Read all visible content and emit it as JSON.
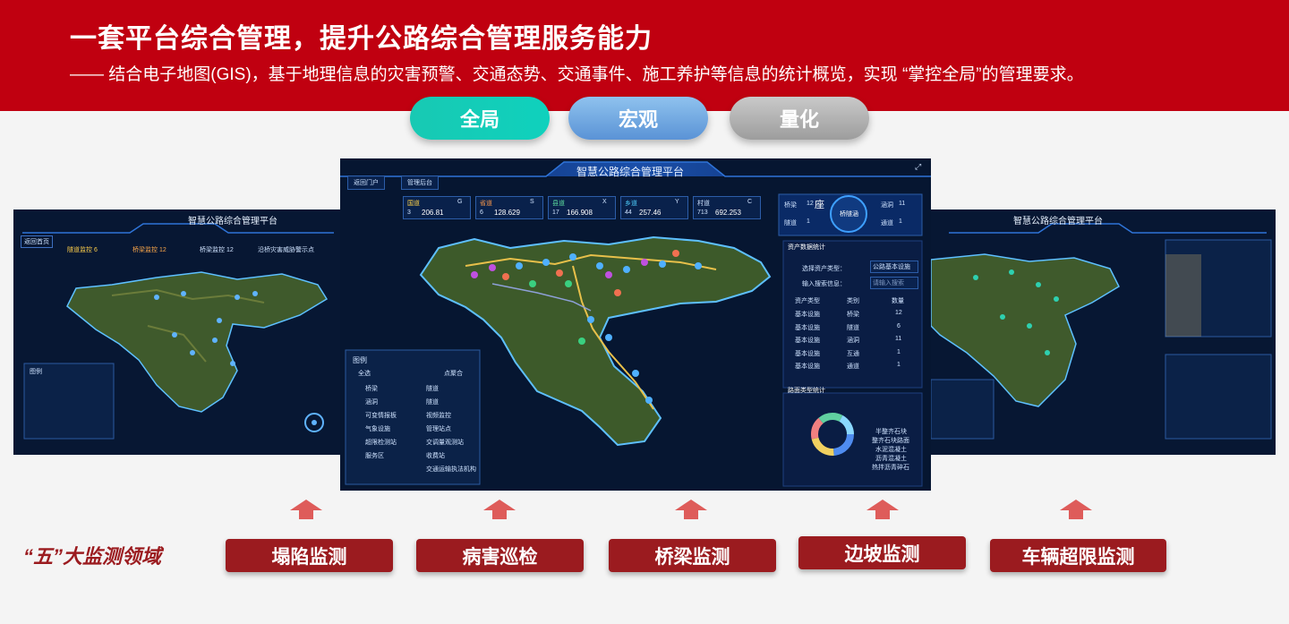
{
  "header": {
    "title": "一套平台综合管理，提升公路综合管理服务能力",
    "subtitle": "—— 结合电子地图(GIS)，基于地理信息的灾害预警、交通态势、交通事件、施工养护等信息的统计概览，实现 “掌控全局”的管理要求。"
  },
  "pills": [
    "全局",
    "宏观",
    "量化"
  ],
  "platform": {
    "title": "智慧公路综合管理平台",
    "back_label": "返回门户",
    "admin_label": "管理后台",
    "stats": [
      {
        "name": "国道",
        "code": "G",
        "count": "3",
        "length": "206.81"
      },
      {
        "name": "省道",
        "code": "S",
        "count": "6",
        "length": "128.629"
      },
      {
        "name": "县道",
        "code": "X",
        "count": "17",
        "length": "166.908"
      },
      {
        "name": "乡道",
        "code": "Y",
        "count": "44",
        "length": "257.46"
      },
      {
        "name": "村道",
        "code": "C",
        "count": "713",
        "length": "692.253"
      }
    ],
    "unit_count": "条",
    "unit_length": "km",
    "bridge": {
      "label": "桥梁",
      "value": "12",
      "unit": "座"
    },
    "culvert": {
      "label": "涵洞",
      "value": "11"
    },
    "tunnel": {
      "label": "隧道",
      "value": "1"
    },
    "passage": {
      "label": "通道",
      "value": "1"
    },
    "bridge_tunnel": "桥隧涵",
    "asset_title": "资产数据统计",
    "asset_type_label": "选择资产类型：",
    "asset_type_value": "公路基本设施",
    "search_label": "输入搜索信息：",
    "search_placeholder": "请输入搜索",
    "table_headers": [
      "资产类型",
      "类别",
      "数量"
    ],
    "table_rows": [
      [
        "基本设施",
        "桥梁",
        "12"
      ],
      [
        "基本设施",
        "隧道",
        "6"
      ],
      [
        "基本设施",
        "涵洞",
        "11"
      ],
      [
        "基本设施",
        "互通",
        "1"
      ],
      [
        "基本设施",
        "通道",
        "1"
      ]
    ],
    "pavement_title": "路面类型统计",
    "pavement_legend": [
      "半整齐石块",
      "整齐石块路面",
      "水泥混凝土",
      "沥青混凝土",
      "热拌沥青碎石"
    ],
    "pavement_colors": [
      "#4f8cf0",
      "#f0d060",
      "#f08080",
      "#60d0a0",
      "#8ad8ff"
    ],
    "legend_title": "图例",
    "legend_all": "全选",
    "legend_cluster": "点聚合",
    "legend_items": [
      "桥梁",
      "隧道",
      "涵洞",
      "隧道",
      "可变情报板",
      "视频监控",
      "气象设施",
      "管理站点",
      "超限检测站",
      "交调量观测站",
      "服务区",
      "收费站",
      "",
      "交通运输执法机构"
    ]
  },
  "left_panel": {
    "title": "智慧公路综合管理平台",
    "back": "返回首页",
    "tabs": [
      "隧道监控 6",
      "桥梁监控 12",
      "桥梁监控 12",
      "沿桥灾害威胁警示点"
    ],
    "legend_title": "图例"
  },
  "right_panel": {
    "title": "智慧公路综合管理平台"
  },
  "five_label": "“五”大监测领域",
  "buttons": [
    "塌陷监测",
    "病害巡检",
    "桥梁监测",
    "边坡监测",
    "车辆超限监测"
  ]
}
